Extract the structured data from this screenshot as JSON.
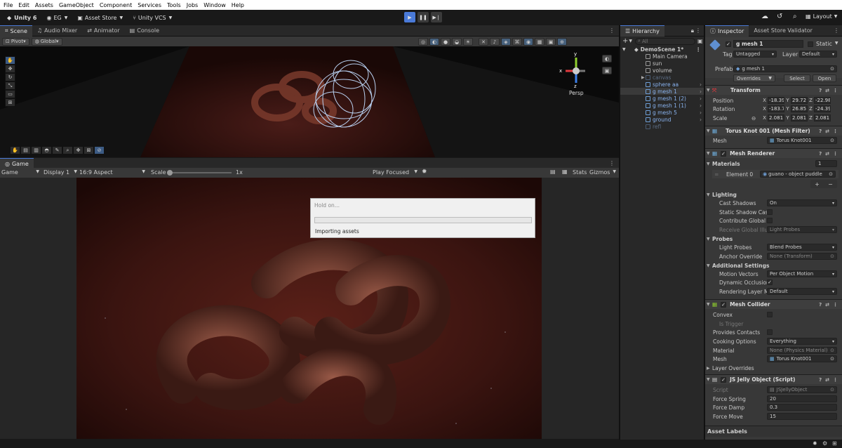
{
  "menu": [
    "File",
    "Edit",
    "Assets",
    "GameObject",
    "Component",
    "Services",
    "Tools",
    "Jobs",
    "Window",
    "Help"
  ],
  "toolbar": {
    "unity_label": "Unity 6",
    "account": "EG",
    "asset_store": "Asset Store",
    "vcs": "Unity VCS",
    "layout": "Layout"
  },
  "scene_tabs": [
    "Scene",
    "Audio Mixer",
    "Animator",
    "Console"
  ],
  "scene_toolbar": {
    "pivot": "Pivot",
    "global": "Global"
  },
  "gizmo": {
    "persp": "Persp",
    "x": "x",
    "y": "y",
    "z": "z"
  },
  "game_tab": "Game",
  "game_toolbar": {
    "mode": "Game",
    "display": "Display 1",
    "aspect": "16:9 Aspect",
    "scale_label": "Scale",
    "scale_value": "1x",
    "play_focused": "Play Focused",
    "stats": "Stats",
    "gizmos": "Gizmos"
  },
  "dialog": {
    "title": "Hold on...",
    "message": "Importing assets",
    "progress": 0
  },
  "hierarchy": {
    "tab": "Hierarchy",
    "search_placeholder": "All",
    "scene": "DemoScene 1*",
    "items": [
      {
        "label": "Main Camera",
        "style": "normal"
      },
      {
        "label": "sun",
        "style": "normal"
      },
      {
        "label": "volume",
        "style": "normal"
      },
      {
        "label": "canvas",
        "style": "dim"
      },
      {
        "label": "sphere aa",
        "style": "prefab"
      },
      {
        "label": "g mesh 1",
        "style": "selected"
      },
      {
        "label": "g mesh 1 (2)",
        "style": "prefab"
      },
      {
        "label": "g mesh 1 (1)",
        "style": "prefab"
      },
      {
        "label": "g mesh 5",
        "style": "prefab"
      },
      {
        "label": "ground",
        "style": "prefab"
      },
      {
        "label": "refl",
        "style": "dim"
      }
    ]
  },
  "inspector": {
    "tab": "Inspector",
    "tab2": "Asset Store Validator",
    "object_name": "g mesh 1",
    "static_label": "Static",
    "tag_label": "Tag",
    "tag_value": "Untagged",
    "layer_label": "Layer",
    "layer_value": "Default",
    "prefab_label": "Prefab",
    "prefab_value": "g mesh 1",
    "overrides": "Overrides",
    "select": "Select",
    "open": "Open",
    "transform": {
      "title": "Transform",
      "position_label": "Position",
      "position": {
        "x": "-18.39",
        "y": "29.72",
        "z": "-22.98"
      },
      "rotation_label": "Rotation",
      "rotation": {
        "x": "-183.7",
        "y": "26.85",
        "z": "-24.39"
      },
      "scale_label": "Scale",
      "scale": {
        "x": "2.081",
        "y": "2.081",
        "z": "2.081"
      }
    },
    "mesh_filter": {
      "title": "Torus Knot 001 (Mesh Filter)",
      "mesh_label": "Mesh",
      "mesh_value": "Torus Knot001"
    },
    "mesh_renderer": {
      "title": "Mesh Renderer",
      "materials_label": "Materials",
      "materials_count": "1",
      "element_label": "Element 0",
      "element_value": "guano - object puddle",
      "lighting": "Lighting",
      "cast_shadows_label": "Cast Shadows",
      "cast_shadows_value": "On",
      "static_shadow_label": "Static Shadow Cas",
      "contribute_gi_label": "Contribute Global",
      "receive_gi_label": "Receive Global Illu",
      "receive_gi_value": "Light Probes",
      "probes": "Probes",
      "light_probes_label": "Light Probes",
      "light_probes_value": "Blend Probes",
      "anchor_label": "Anchor Override",
      "anchor_value": "None (Transform)",
      "additional": "Additional Settings",
      "motion_label": "Motion Vectors",
      "motion_value": "Per Object Motion",
      "occlusion_label": "Dynamic Occlusion",
      "rendering_layer_label": "Rendering Layer M",
      "rendering_layer_value": "Default"
    },
    "mesh_collider": {
      "title": "Mesh Collider",
      "convex_label": "Convex",
      "trigger_label": "Is Trigger",
      "contacts_label": "Provides Contacts",
      "cooking_label": "Cooking Options",
      "cooking_value": "Everything",
      "material_label": "Material",
      "material_value": "None (Physics Material)",
      "mesh_label": "Mesh",
      "mesh_value": "Torus Knot001",
      "layer_overrides": "Layer Overrides"
    },
    "script": {
      "title": "JS Jelly Object (Script)",
      "script_label": "Script",
      "script_value": "JSJellyObject",
      "spring_label": "Force Spring",
      "spring_value": "20",
      "damp_label": "Force Damp",
      "damp_value": "0.3",
      "move_label": "Force Move",
      "move_value": "15"
    },
    "asset_labels": "Asset Labels"
  },
  "colors": {
    "accent": "#4a7ad8",
    "selection": "#3c5b84",
    "ground": "#3a1410",
    "gizmo_x": "#e0393e",
    "gizmo_y": "#8fce2d",
    "gizmo_z": "#3b7fe8"
  }
}
